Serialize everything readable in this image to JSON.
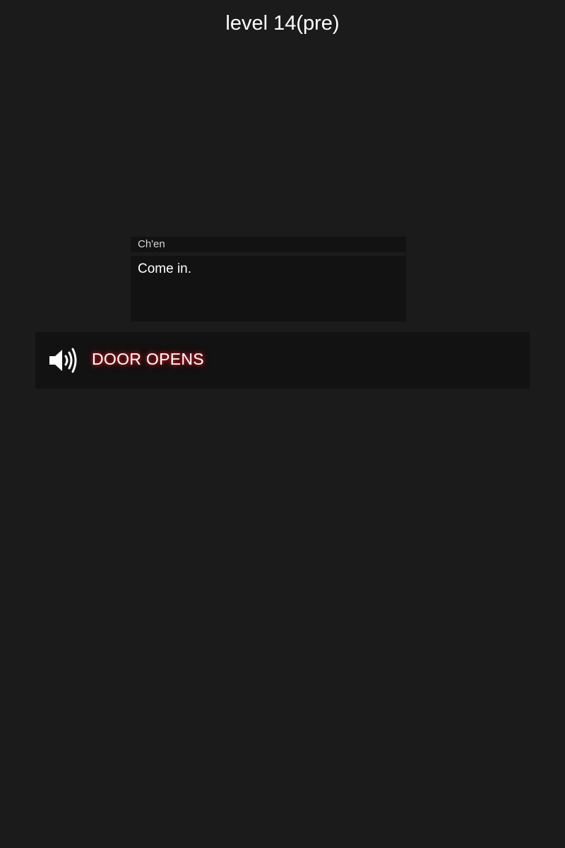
{
  "level": {
    "title": "level 14(pre)"
  },
  "dialogue": {
    "speaker": "Ch'en",
    "text": "Come in."
  },
  "sound_effect": {
    "icon": "speaker-volume-icon",
    "label": "DOOR OPENS",
    "glow_color": "#c2232a"
  },
  "colors": {
    "background": "#1b1b1b",
    "panel": "#121212",
    "text": "#ffffff"
  }
}
